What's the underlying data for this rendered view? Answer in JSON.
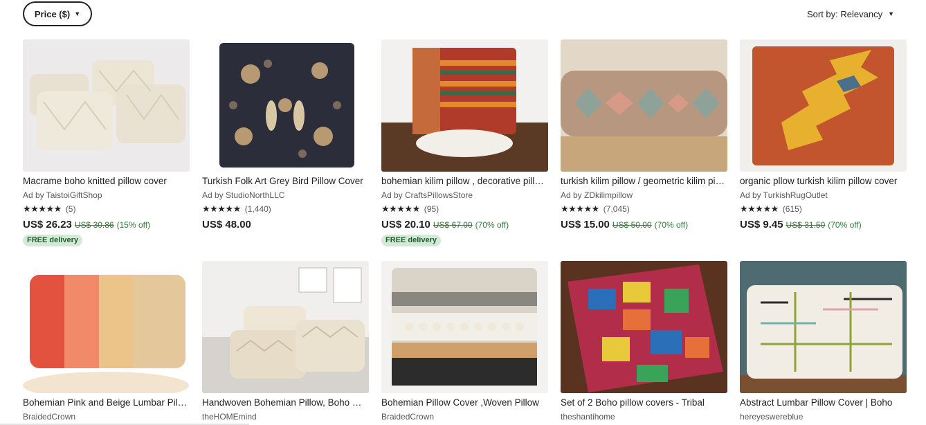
{
  "filters": {
    "price_label": "Price ($)",
    "sort_label": "Sort by: Relevancy"
  },
  "listings": [
    {
      "title": "Macrame boho knitted pillow cover",
      "shop": "Ad by TaistoiGiftShop",
      "stars": "★★★★★",
      "reviews": "(5)",
      "price": "US$ 26.23",
      "original_price": "US$ 30.86",
      "discount": "(15% off)",
      "badge": "FREE delivery"
    },
    {
      "title": "Turkish Folk Art Grey Bird Pillow Cover",
      "shop": "Ad by StudioNorthLLC",
      "stars": "★★★★★",
      "reviews": "(1,440)",
      "price": "US$ 48.00",
      "original_price": "",
      "discount": "",
      "badge": ""
    },
    {
      "title": "bohemian kilim pillow , decorative pillow",
      "shop": "Ad by CraftsPillowsStore",
      "stars": "★★★★★",
      "reviews": "(95)",
      "price": "US$ 20.10",
      "original_price": "US$ 67.00",
      "discount": "(70% off)",
      "badge": "FREE delivery"
    },
    {
      "title": "turkish kilim pillow / geometric kilim pillow",
      "shop": "Ad by ZDkilimpillow",
      "stars": "★★★★★",
      "reviews": "(7,045)",
      "price": "US$ 15.00",
      "original_price": "US$ 50.00",
      "discount": "(70% off)",
      "badge": ""
    },
    {
      "title": "organic pllow turkish kilim pillow cover",
      "shop": "Ad by TurkishRugOutlet",
      "stars": "★★★★★",
      "reviews": "(615)",
      "price": "US$ 9.45",
      "original_price": "US$ 31.50",
      "discount": "(70% off)",
      "badge": ""
    },
    {
      "title": "Bohemian Pink and Beige Lumbar Pillow",
      "shop": "BraidedCrown"
    },
    {
      "title": "Handwoven Bohemian Pillow, Boho Pillow",
      "shop": "theHOMEmind"
    },
    {
      "title": "Bohemian Pillow Cover ,Woven Pillow",
      "shop": "BraidedCrown"
    },
    {
      "title": "Set of 2 Boho pillow covers - Tribal",
      "shop": "theshantihome"
    },
    {
      "title": "Abstract Lumbar Pillow Cover | Boho",
      "shop": "hereyeswereblue"
    }
  ],
  "colors": {
    "discount_green": "#2f7a3b",
    "badge_bg": "#d4e9d7",
    "text": "#222222"
  },
  "icons": {
    "caret": "caret-down-icon",
    "star": "star-icon"
  }
}
